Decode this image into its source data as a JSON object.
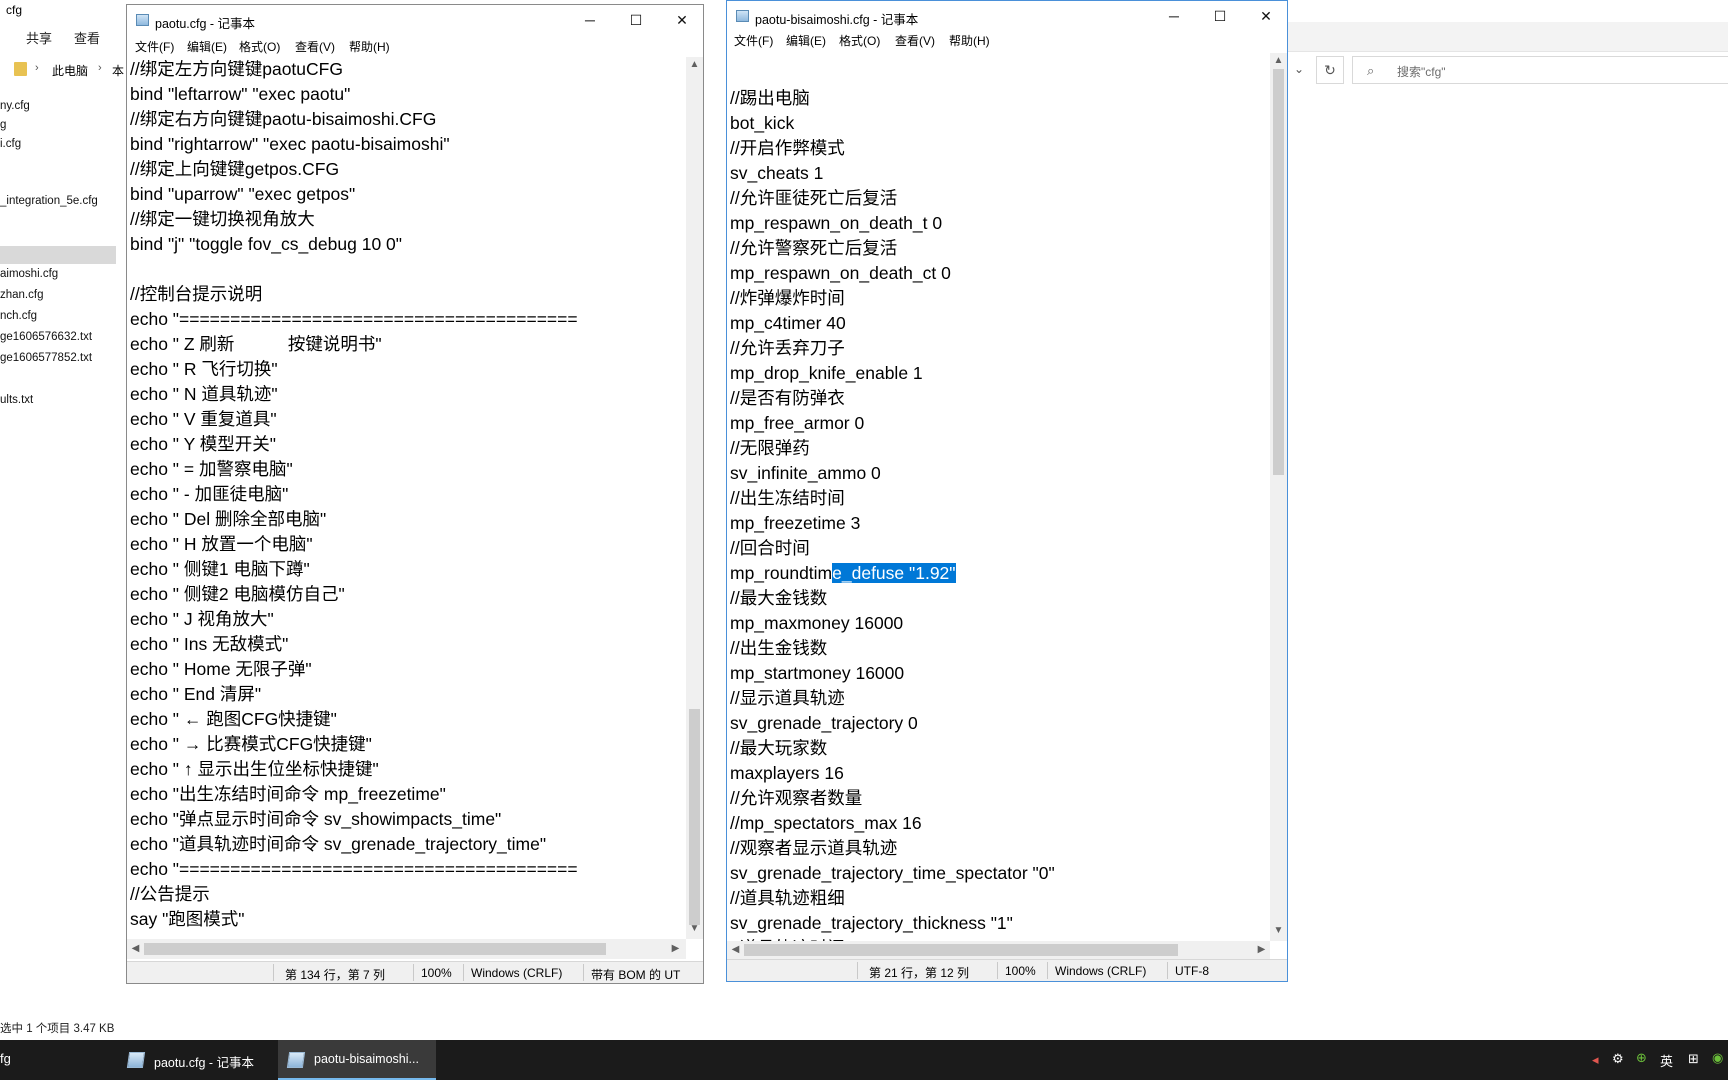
{
  "explorer": {
    "title": "cfg",
    "ribbon": [
      "共享",
      "查看"
    ],
    "address": {
      "this_pc": "此电脑",
      "crumb": "本"
    },
    "search_placeholder": "搜索\"cfg\"",
    "files": [
      "ny.cfg",
      "g",
      "i.cfg",
      "",
      "_integration_5e.cfg",
      "",
      "",
      "aimoshi.cfg",
      "zhan.cfg",
      "nch.cfg",
      "ge1606576632.txt",
      "ge1606577852.txt",
      "",
      "ults.txt"
    ],
    "status": "选中 1 个项目  3.47 KB"
  },
  "left_notepad": {
    "title": "paotu.cfg - 记事本",
    "menu": [
      "文件(F)",
      "编辑(E)",
      "格式(O)",
      "查看(V)",
      "帮助(H)"
    ],
    "lines": [
      "//绑定左方向键键paotuCFG",
      "bind \"leftarrow\" \"exec paotu\"",
      "//绑定右方向键键paotu-bisaimoshi.CFG",
      "bind \"rightarrow\" \"exec paotu-bisaimoshi\"",
      "//绑定上向键键getpos.CFG",
      "bind \"uparrow\" \"exec getpos\"",
      "//绑定一键切换视角放大",
      "bind \"j\" \"toggle fov_cs_debug 10 0\"",
      "",
      "//控制台提示说明",
      "echo \"=======================================",
      "echo \" Z 刷新           按键说明书\"",
      "echo \" R 飞行切换\"",
      "echo \" N 道具轨迹\"",
      "echo \" V 重复道具\"",
      "echo \" Y 模型开关\"",
      "echo \" = 加警察电脑\"",
      "echo \" - 加匪徒电脑\"",
      "echo \" Del 删除全部电脑\"",
      "echo \" H 放置一个电脑\"",
      "echo \" 侧键1 电脑下蹲\"",
      "echo \" 侧键2 电脑模仿自己\"",
      "echo \" J 视角放大\"",
      "echo \" Ins 无敌模式\"",
      "echo \" Home 无限子弹\"",
      "echo \" End 清屏\"",
      "echo \" ← 跑图CFG快捷键\"",
      "echo \" → 比赛模式CFG快捷键\"",
      "echo \" ↑ 显示出生位坐标快捷键\"",
      "echo \"出生冻结时间命令 mp_freezetime\"",
      "echo \"弹点显示时间命令 sv_showimpacts_time\"",
      "echo \"道具轨迹时间命令 sv_grenade_trajectory_time\"",
      "echo \"=======================================",
      "//公告提示",
      "say \"跑图模式\""
    ],
    "status": {
      "position": "第 134 行，第 7 列",
      "zoom": "100%",
      "eol": "Windows (CRLF)",
      "encoding": "带有 BOM 的 UT"
    }
  },
  "right_notepad": {
    "title": "paotu-bisaimoshi.cfg - 记事本",
    "menu": [
      "文件(F)",
      "编辑(E)",
      "格式(O)",
      "查看(V)",
      "帮助(H)"
    ],
    "lines": [
      "",
      "//踢出电脑",
      "bot_kick",
      "//开启作弊模式",
      "sv_cheats 1",
      "//允许匪徒死亡后复活",
      "mp_respawn_on_death_t 0",
      "//允许警察死亡后复活",
      "mp_respawn_on_death_ct 0",
      "//炸弹爆炸时间",
      "mp_c4timer 40",
      "//允许丢弃刀子",
      "mp_drop_knife_enable 1",
      "//是否有防弹衣",
      "mp_free_armor 0",
      "//无限弹药",
      "sv_infinite_ammo 0",
      "//出生冻结时间",
      "mp_freezetime 3",
      "//回合时间",
      "__SELECTED__",
      "//最大金钱数",
      "mp_maxmoney 16000",
      "//出生金钱数",
      "mp_startmoney 16000",
      "//显示道具轨迹",
      "sv_grenade_trajectory 0",
      "//最大玩家数",
      "maxplayers 16",
      "//允许观察者数量",
      "//mp_spectators_max 16",
      "//观察者显示道具轨迹",
      "sv_grenade_trajectory_time_spectator \"0\"",
      "//道具轨迹粗细",
      "sv_grenade_trajectory_thickness \"1\"",
      "//道具轨迹时间"
    ],
    "selected_line": {
      "before": "mp_roundtim",
      "selected": "e_defuse \"1.92\""
    },
    "status": {
      "position": "第 21 行，第 12 列",
      "zoom": "100%",
      "eol": "Windows (CRLF)",
      "encoding": "UTF-8"
    }
  },
  "taskbar": {
    "left_label": "fg",
    "tasks": [
      {
        "label": "paotu.cfg - 记事本",
        "active": false
      },
      {
        "label": "paotu-bisaimoshi...",
        "active": true
      }
    ],
    "tray_lang": "英"
  }
}
